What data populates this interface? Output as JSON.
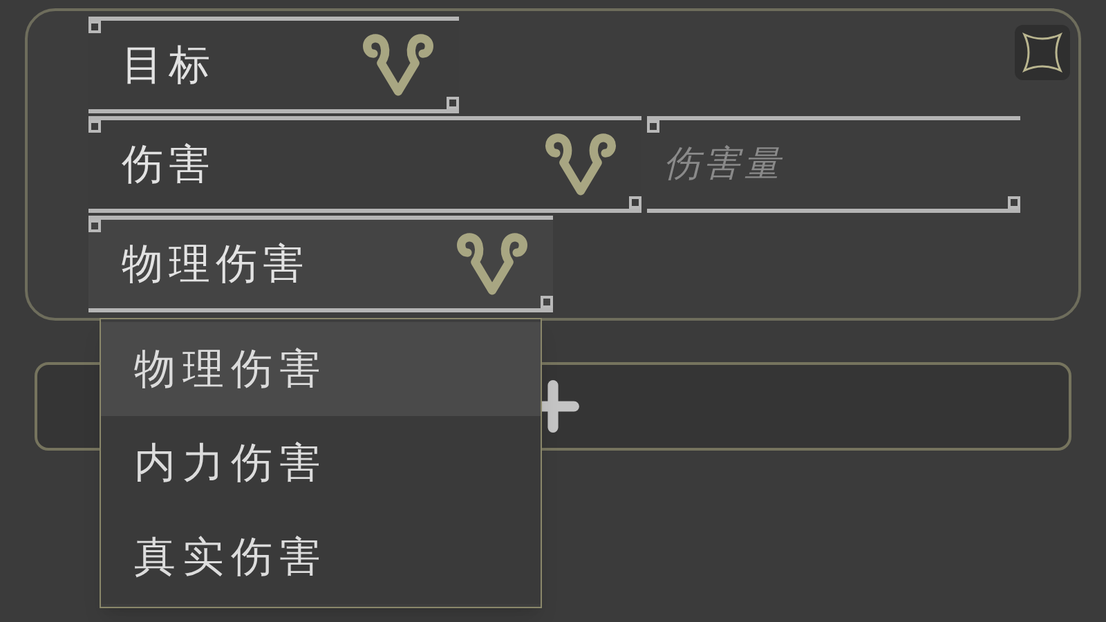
{
  "form": {
    "rows": [
      {
        "kind": "dropdown",
        "value": "目标"
      },
      {
        "kind": "dropdown",
        "value": "伤害",
        "field": {
          "placeholder": "伤害量"
        }
      },
      {
        "kind": "dropdown",
        "value": "物理伤害",
        "expanded": true,
        "options": [
          {
            "label": "物理伤害",
            "selected": true
          },
          {
            "label": "内力伤害",
            "selected": false
          },
          {
            "label": "真实伤害",
            "selected": false
          }
        ]
      }
    ]
  }
}
